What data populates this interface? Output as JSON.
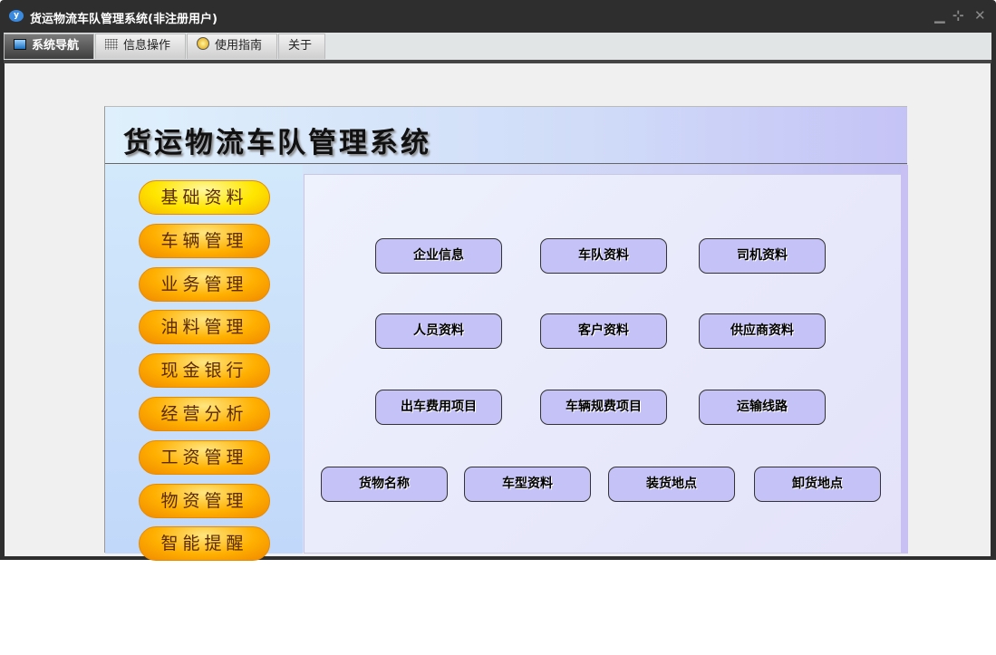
{
  "window": {
    "title": "货运物流车队管理系统(非注册用户)",
    "icon": "app-logo-icon",
    "controls": [
      "minimize-icon",
      "restore-icon",
      "close-icon"
    ]
  },
  "tabs": [
    {
      "label": "系统导航",
      "icon": "monitor-icon",
      "active": true
    },
    {
      "label": "信息操作",
      "icon": "grid-icon"
    },
    {
      "label": "使用指南",
      "icon": "help-icon"
    },
    {
      "label": "关于"
    }
  ],
  "banner": {
    "title": "货运物流车队管理系统"
  },
  "side_menu": [
    "基础资料",
    "车辆管理",
    "业务管理",
    "油料管理",
    "现金银行",
    "经营分析",
    "工资管理",
    "物资管理",
    "智能提醒"
  ],
  "functions": [
    "企业信息",
    "车队资料",
    "司机资料",
    "人员资料",
    "客户资料",
    "供应商资料",
    "出车费用项目",
    "车辆规费项目",
    "运输线路",
    "货物名称",
    "车型资料",
    "装货地点",
    "卸货地点"
  ]
}
